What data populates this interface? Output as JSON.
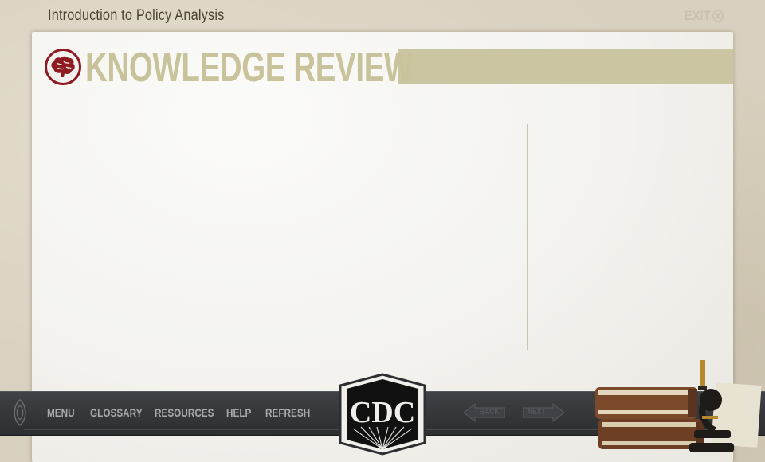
{
  "header": {
    "course_title": "Introduction to Policy Analysis",
    "exit_label": "EXIT"
  },
  "section": {
    "title": "KNOWLEDGE REVIEW",
    "icon": "brain-icon"
  },
  "navbar": {
    "items": [
      {
        "label": "MENU"
      },
      {
        "label": "GLOSSARY"
      },
      {
        "label": "RESOURCES"
      },
      {
        "label": "HELP"
      },
      {
        "label": "REFRESH"
      }
    ],
    "logo_text": "CDC",
    "back_label": "BACK",
    "next_label": "NEXT"
  },
  "colors": {
    "accent_red": "#8e1b22",
    "title_khaki": "#c8c39a",
    "band_khaki": "#cbc6a2",
    "navbar_dark": "#2c2e31"
  }
}
